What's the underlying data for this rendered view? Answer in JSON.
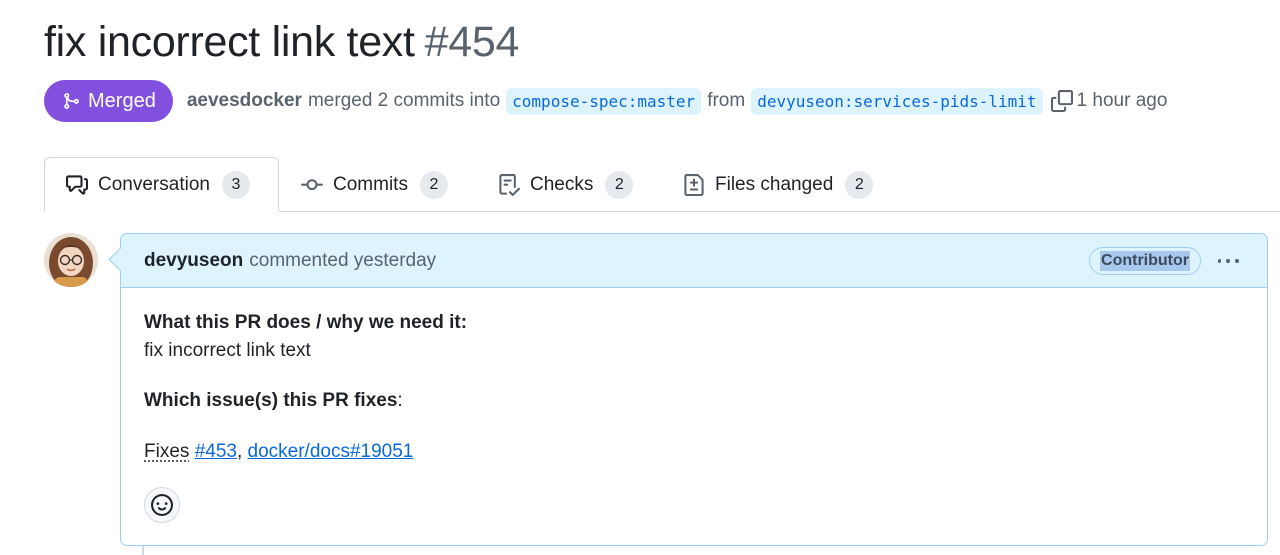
{
  "pr": {
    "title": "fix incorrect link text",
    "number": "#454",
    "state": "Merged",
    "author": "aevesdocker",
    "action": "merged 2 commits into",
    "base_branch": "compose-spec:master",
    "from_word": "from",
    "head_branch": "devyuseon:services-pids-limit",
    "time": "1 hour ago"
  },
  "tabs": [
    {
      "label": "Conversation",
      "count": "3",
      "icon": "comment-discussion-icon",
      "selected": true
    },
    {
      "label": "Commits",
      "count": "2",
      "icon": "git-commit-icon"
    },
    {
      "label": "Checks",
      "count": "2",
      "icon": "checklist-icon"
    },
    {
      "label": "Files changed",
      "count": "2",
      "icon": "file-diff-icon"
    }
  ],
  "comment": {
    "author": "devyuseon",
    "action": "commented yesterday",
    "role": "Contributor",
    "heading1": "What this PR does / why we need it:",
    "text1": "fix incorrect link text",
    "heading2_bold": "Which issue(s) this PR fixes",
    "heading2_colon": ":",
    "fixes_label": "Fixes",
    "link1": "#453",
    "separator": ",",
    "link2": "docker/docs#19051"
  },
  "colors": {
    "merged": "#8250df",
    "link": "#0969da",
    "comment_header_bg": "#ddf4ff",
    "comment_border": "#9fcdf5"
  }
}
